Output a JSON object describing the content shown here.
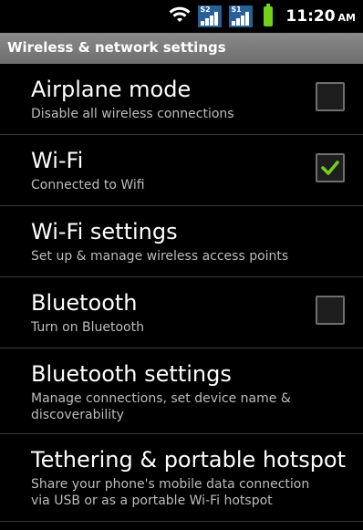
{
  "status_bar": {
    "icons": [
      "wifi-icon",
      "sim-s2-signal-icon",
      "sim-s1-signal-icon",
      "battery-icon"
    ],
    "sim_labels": [
      "S2",
      "S1"
    ],
    "time": "11:20",
    "ampm": "AM"
  },
  "title_bar": {
    "title": "Wireless & network settings"
  },
  "settings": [
    {
      "title": "Airplane mode",
      "summary": "Disable all wireless connections",
      "checkbox": true,
      "checked": false
    },
    {
      "title": "Wi-Fi",
      "summary": "Connected to Wifi",
      "checkbox": true,
      "checked": true
    },
    {
      "title": "Wi-Fi settings",
      "summary": "Set up & manage wireless access points",
      "checkbox": false
    },
    {
      "title": "Bluetooth",
      "summary": "Turn on Bluetooth",
      "checkbox": true,
      "checked": false
    },
    {
      "title": "Bluetooth settings",
      "summary": "Manage connections, set device name & discoverability",
      "checkbox": false
    },
    {
      "title": "Tethering & portable hotspot",
      "summary": "Share your phone's mobile data connection via USB or as a portable Wi-Fi hotspot",
      "checkbox": false
    }
  ],
  "colors": {
    "accent_green": "#74d11b",
    "title_bar_bg": "#7a7a7a"
  }
}
